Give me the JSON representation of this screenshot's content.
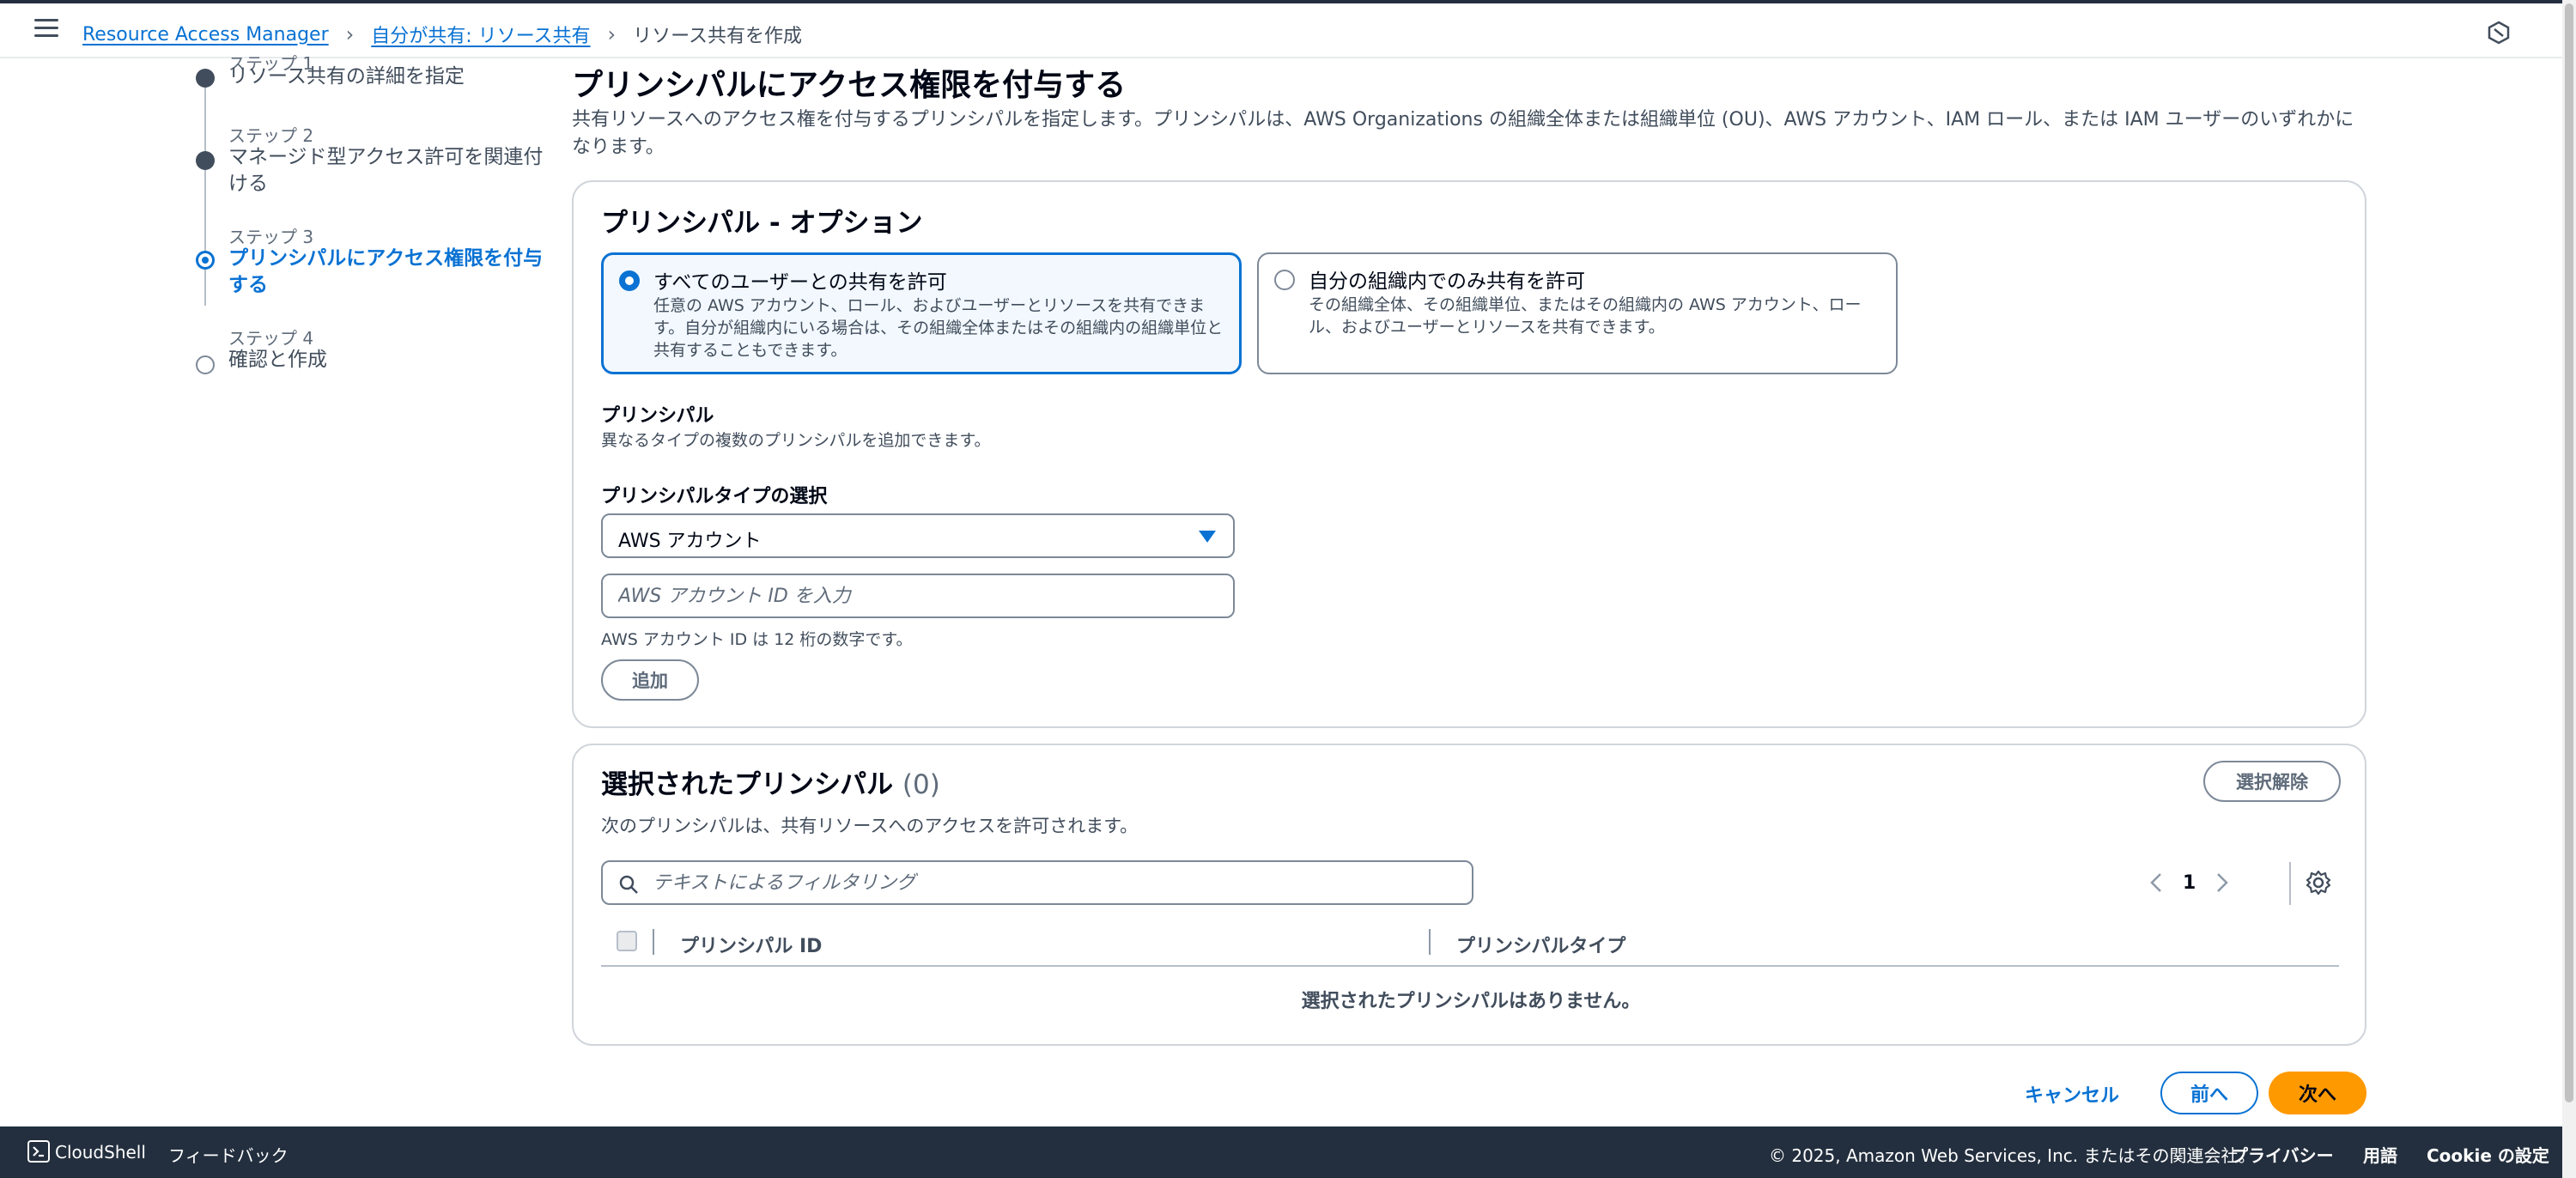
{
  "breadcrumb": {
    "items": [
      "Resource Access Manager",
      "自分が共有: リソース共有"
    ],
    "current": "リソース共有を作成"
  },
  "stepper": {
    "steps": [
      {
        "label": "ステップ 1",
        "title": "リソース共有の詳細を指定",
        "state": "done"
      },
      {
        "label": "ステップ 2",
        "title": "マネージド型アクセス許可を関連付ける",
        "state": "done"
      },
      {
        "label": "ステップ 3",
        "title": "プリンシパルにアクセス権限を付与する",
        "state": "active"
      },
      {
        "label": "ステップ 4",
        "title": "確認と作成",
        "state": "todo"
      }
    ]
  },
  "page": {
    "title": "プリンシパルにアクセス権限を付与する",
    "description": "共有リソースへのアクセス権を付与するプリンシパルを指定します。プリンシパルは、AWS Organizations の組織全体または組織単位 (OU)、AWS アカウント、IAM ロール、または IAM ユーザーのいずれかになります。"
  },
  "principal_options": {
    "heading": "プリンシパル - オプション",
    "tiles": [
      {
        "title": "すべてのユーザーとの共有を許可",
        "description": "任意の AWS アカウント、ロール、およびユーザーとリソースを共有できます。自分が組織内にいる場合は、その組織全体またはその組織内の組織単位と共有することもできます。",
        "selected": true
      },
      {
        "title": "自分の組織内でのみ共有を許可",
        "description": "その組織全体、その組織単位、またはその組織内の AWS アカウント、ロール、およびユーザーとリソースを共有できます。",
        "selected": false
      }
    ],
    "principals_label": "プリンシパル",
    "principals_desc": "異なるタイプの複数のプリンシパルを追加できます。",
    "type_label": "プリンシパルタイプの選択",
    "type_value": "AWS アカウント",
    "id_placeholder": "AWS アカウント ID を入力",
    "id_value": "",
    "id_hint": "AWS アカウント ID は 12 桁の数字です。",
    "add_button": "追加"
  },
  "selected_principals": {
    "heading": "選択されたプリンシパル",
    "count": "(0)",
    "clear_button": "選択解除",
    "description": "次のプリンシパルは、共有リソースへのアクセスを許可されます。",
    "filter_placeholder": "テキストによるフィルタリング",
    "page_number": "1",
    "columns": [
      "プリンシパル ID",
      "プリンシパルタイプ"
    ],
    "empty_message": "選択されたプリンシパルはありません。"
  },
  "actions": {
    "cancel": "キャンセル",
    "previous": "前へ",
    "next": "次へ"
  },
  "footer": {
    "cloudshell": "CloudShell",
    "feedback": "フィードバック",
    "copyright": "© 2025, Amazon Web Services, Inc. またはその関連会社。",
    "privacy": "プライバシー",
    "terms": "用語",
    "cookie": "Cookie の設定"
  },
  "colors": {
    "accent": "#0972d3",
    "primary_button": "#ff9900",
    "footer_bg": "#232f3e"
  }
}
